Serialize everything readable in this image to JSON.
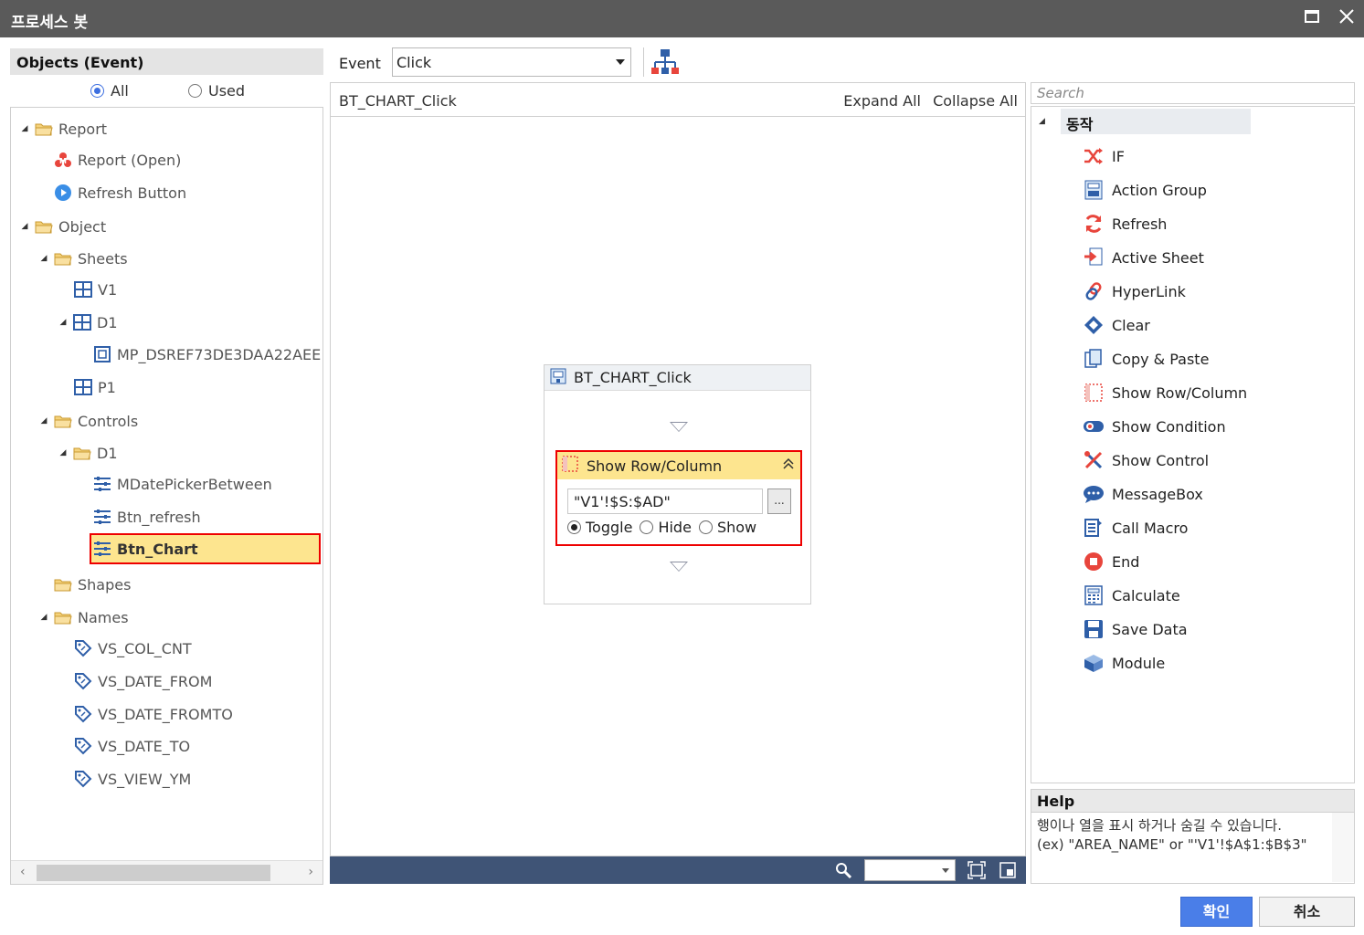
{
  "window": {
    "title": "프로세스 봇"
  },
  "objects_panel": {
    "header": "Objects (Event)",
    "filter": {
      "all": "All",
      "used": "Used",
      "selected": "all"
    },
    "tree": [
      {
        "label": "Report",
        "icon": "folder-icon"
      },
      {
        "label": "Report (Open)",
        "icon": "report-open-icon"
      },
      {
        "label": "Refresh Button",
        "icon": "play-circle-icon"
      },
      {
        "label": "Object",
        "icon": "folder-icon"
      },
      {
        "label": "Sheets",
        "icon": "folder-icon"
      },
      {
        "label": "V1",
        "icon": "grid-icon"
      },
      {
        "label": "D1",
        "icon": "grid-icon"
      },
      {
        "label": "MP_DSREF73DE3DAA22AEE",
        "icon": "map-ref-icon"
      },
      {
        "label": "P1",
        "icon": "grid-icon"
      },
      {
        "label": "Controls",
        "icon": "folder-icon"
      },
      {
        "label": "D1",
        "icon": "folder-icon"
      },
      {
        "label": "MDatePickerBetween",
        "icon": "control-icon"
      },
      {
        "label": "Btn_refresh",
        "icon": "control-icon"
      },
      {
        "label": "Btn_Chart",
        "icon": "control-icon",
        "selected": true
      },
      {
        "label": "Shapes",
        "icon": "folder-icon"
      },
      {
        "label": "Names",
        "icon": "folder-icon"
      },
      {
        "label": "VS_COL_CNT",
        "icon": "tag-icon"
      },
      {
        "label": "VS_DATE_FROM",
        "icon": "tag-icon"
      },
      {
        "label": "VS_DATE_FROMTO",
        "icon": "tag-icon"
      },
      {
        "label": "VS_DATE_TO",
        "icon": "tag-icon"
      },
      {
        "label": "VS_VIEW_YM",
        "icon": "tag-icon"
      }
    ]
  },
  "event_bar": {
    "label": "Event",
    "value": "Click"
  },
  "flow": {
    "name": "BT_CHART_Click",
    "expand_all": "Expand All",
    "collapse_all": "Collapse All",
    "block": {
      "title": "BT_CHART_Click",
      "action": {
        "title": "Show Row/Column",
        "value": "\"V1'!$S:$AD\"",
        "browse": "...",
        "options": [
          "Toggle",
          "Hide",
          "Show"
        ],
        "selected": "Toggle"
      }
    }
  },
  "actions_panel": {
    "search_placeholder": "Search",
    "category": "동작",
    "items": [
      {
        "label": "IF",
        "icon": "shuffle-icon"
      },
      {
        "label": "Action Group",
        "icon": "action-group-icon"
      },
      {
        "label": "Refresh",
        "icon": "refresh-icon"
      },
      {
        "label": "Active Sheet",
        "icon": "active-sheet-icon"
      },
      {
        "label": "HyperLink",
        "icon": "link-icon"
      },
      {
        "label": "Clear",
        "icon": "eraser-icon"
      },
      {
        "label": "Copy & Paste",
        "icon": "copy-icon"
      },
      {
        "label": "Show Row/Column",
        "icon": "show-row-column-icon"
      },
      {
        "label": "Show Condition",
        "icon": "toggle-icon"
      },
      {
        "label": "Show Control",
        "icon": "tools-icon"
      },
      {
        "label": "MessageBox",
        "icon": "message-icon"
      },
      {
        "label": "Call Macro",
        "icon": "macro-icon"
      },
      {
        "label": "End",
        "icon": "stop-icon"
      },
      {
        "label": "Calculate",
        "icon": "calculator-icon"
      },
      {
        "label": "Save Data",
        "icon": "save-icon"
      },
      {
        "label": "Module",
        "icon": "module-icon"
      }
    ]
  },
  "help": {
    "header": "Help",
    "line1": "행이나 열을 표시 하거나 숨길 수 있습니다.",
    "line2": "(ex) \"AREA_NAME\" or \"'V1'!$A$1:$B$3\""
  },
  "buttons": {
    "ok": "확인",
    "cancel": "취소"
  },
  "colors": {
    "titlebar": "#5a5a5a",
    "selection": "#fde58f",
    "highlight_border": "#e00000",
    "primary": "#4a7ee8",
    "statusbar": "#3f5476"
  }
}
